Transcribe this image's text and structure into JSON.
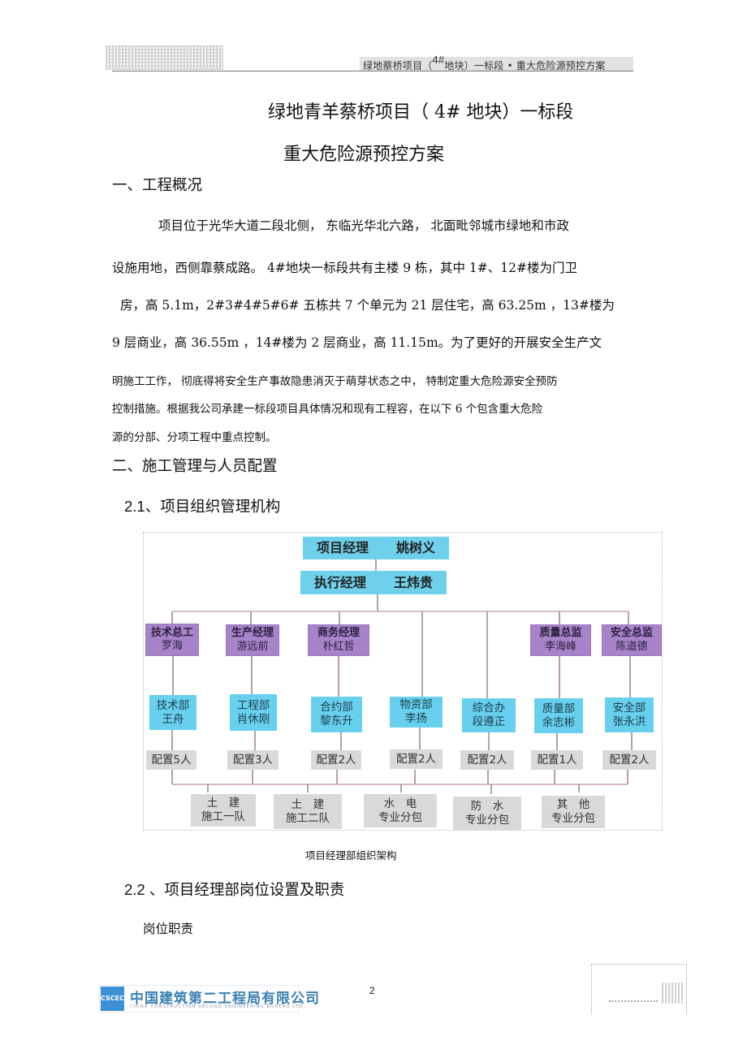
{
  "header": {
    "running_title_pre": "绿地蔡桥项目（",
    "running_title_sup": "4#",
    "running_title_post": "地块）一标段 • 重大危险源预控方案"
  },
  "title": {
    "line1": "绿地青羊蔡桥项目（ 4# 地块）一标段",
    "line2": "重大危险源预控方案"
  },
  "section1": {
    "heading": "一、工程概况",
    "paragraph_lines": [
      "项目位于光华大道二段北侧，  东临光华北六路，  北面毗邻城市绿地和市政",
      "设施用地，西侧靠蔡成路。 4#地块一标段共有主楼    9 栋，其中 1#、12#楼为门卫",
      "房，高 5.1m，2#3#4#5#6# 五栋共 7 个单元为 21 层住宅，高 63.25m ，13#楼为",
      "9 层商业，高 36.55m ，14#楼为 2 层商业，高 11.15m。为了更好的开展安全生产文",
      "明施工工作，  彻底得将安全生产事故隐患消灭于萌芽状态之中，          特制定重大危险源安全预防",
      "控制措施。根据我公司承建一标段项目具体情况和现有工程容，在以下            6  个包含重大危险",
      "源的分部、分项工程中重点控制。"
    ]
  },
  "section2": {
    "heading": "二、施工管理与人员配置",
    "sub1": "2.1、项目组织管理机构",
    "org_chart": {
      "project_manager": {
        "role": "项目经理",
        "name": "姚树义"
      },
      "executive_manager": {
        "role": "执行经理",
        "name": "王炜贵"
      },
      "directors": [
        {
          "role": "技术总工",
          "name": "罗海"
        },
        {
          "role": "生产经理",
          "name": "游远前"
        },
        {
          "role": "商务经理",
          "name": "朴红哲"
        },
        {
          "role": "质量总监",
          "name": "李海峰"
        },
        {
          "role": "安全总监",
          "name": "陈道德"
        }
      ],
      "departments": [
        {
          "dept": "技术部",
          "name": "王舟",
          "staffing": "配置5人"
        },
        {
          "dept": "工程部",
          "name": "肖休刚",
          "staffing": "配置3人"
        },
        {
          "dept": "合约部",
          "name": "黎东升",
          "staffing": "配置2人"
        },
        {
          "dept": "物资部",
          "name": "李扬",
          "staffing": "配置2人"
        },
        {
          "dept": "综合办",
          "name": "段遵正",
          "staffing": "配置2人"
        },
        {
          "dept": "质量部",
          "name": "余志彬",
          "staffing": "配置1人"
        },
        {
          "dept": "安全部",
          "name": "张永洪",
          "staffing": "配置2人"
        }
      ],
      "teams": [
        {
          "line1": "土　建",
          "line2": "施工一队"
        },
        {
          "line1": "土　建",
          "line2": "施工二队"
        },
        {
          "line1": "水　电",
          "line2": "专业分包"
        },
        {
          "line1": "防　水",
          "line2": "专业分包"
        },
        {
          "line1": "其　他",
          "line2": "专业分包"
        }
      ],
      "caption": "项目经理部组织架构"
    },
    "sub2": "2.2 、项目经理部岗位设置及职责",
    "sub2_text": "岗位职责"
  },
  "footer": {
    "company_cn": "中国建筑第二工程局有限公司",
    "company_en": "CHINA CONSTRUCTION SECOND ENGINEERING BUREAU LTD.",
    "logo_text": "CSCEC",
    "page_number": "2"
  }
}
